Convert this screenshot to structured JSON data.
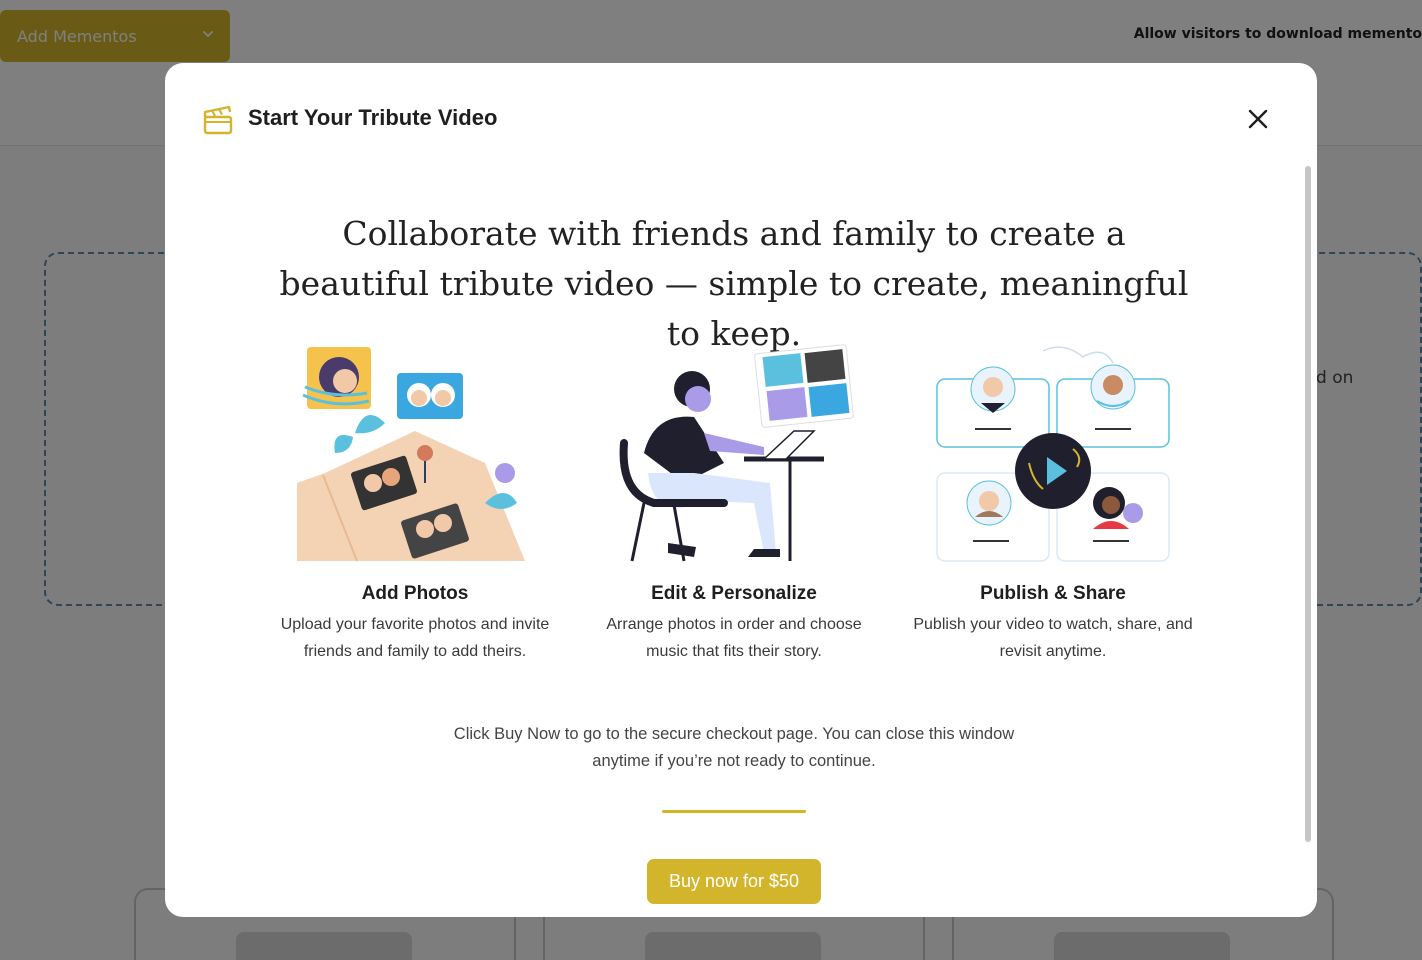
{
  "background": {
    "add_mementos_label": "Add Mementos",
    "allow_download_label": "Allow visitors to download memento",
    "side_text": "d on"
  },
  "modal": {
    "title": "Start Your Tribute Video",
    "headline": "Collaborate with friends and family to create a beautiful tribute video — simple to create, meaningful to keep.",
    "steps": [
      {
        "title": "Add Photos",
        "description": "Upload your favorite photos and invite friends and family to add theirs.",
        "illustration": "photo-album-illustration"
      },
      {
        "title": "Edit & Personalize",
        "description": "Arrange photos in order and choose music that fits their story.",
        "illustration": "person-at-laptop-illustration"
      },
      {
        "title": "Publish & Share",
        "description": "Publish your video to watch, share, and revisit anytime.",
        "illustration": "shared-video-network-illustration"
      }
    ],
    "note": "Click Buy Now to go to the secure checkout page. You can close this window anytime if you’re not ready to continue.",
    "buy_button_label": "Buy now for $50"
  },
  "colors": {
    "accent": "#d3b52c",
    "overlay": "rgba(0,0,0,0.5)",
    "title_text": "#1e1e1e",
    "illustration_blue": "#5bc0de",
    "illustration_purple": "#a99be8"
  }
}
